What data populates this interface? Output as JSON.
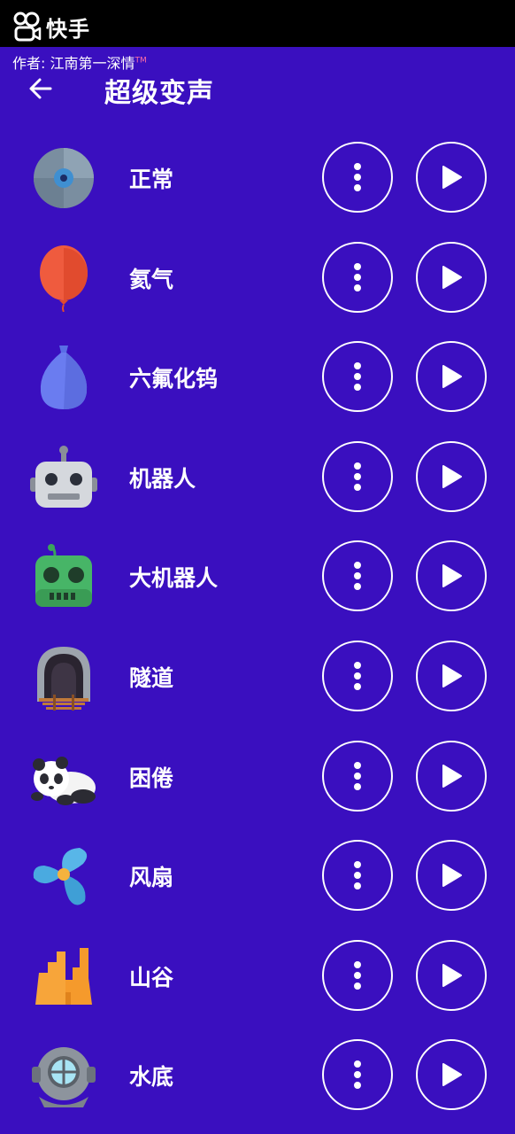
{
  "app_brand": {
    "name": "快手",
    "icon": "kuaishou-logo"
  },
  "author": {
    "text": "作者: 江南第一深情",
    "mark": "TM"
  },
  "header": {
    "back_icon": "arrow-left-icon",
    "title": "超级变声"
  },
  "colors": {
    "background": "#3a0fbf",
    "topbar": "#000000",
    "foreground": "#ffffff"
  },
  "voices": [
    {
      "label": "正常",
      "icon": "cd-icon"
    },
    {
      "label": "氦气",
      "icon": "red-balloon-icon"
    },
    {
      "label": "六氟化钨",
      "icon": "blue-balloon-icon"
    },
    {
      "label": "机器人",
      "icon": "robot-icon"
    },
    {
      "label": "大机器人",
      "icon": "green-robot-icon"
    },
    {
      "label": "隧道",
      "icon": "tunnel-icon"
    },
    {
      "label": "困倦",
      "icon": "panda-icon"
    },
    {
      "label": "风扇",
      "icon": "fan-icon"
    },
    {
      "label": "山谷",
      "icon": "valley-icon"
    },
    {
      "label": "水底",
      "icon": "diving-helmet-icon"
    }
  ],
  "row_actions": {
    "more_icon": "more-vertical-icon",
    "play_icon": "play-icon"
  }
}
